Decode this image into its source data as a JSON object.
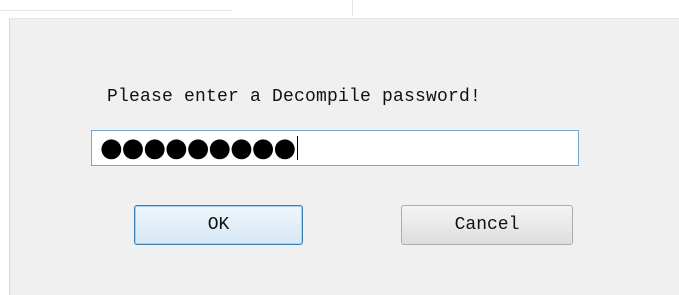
{
  "dialog": {
    "prompt": "Please enter a Decompile password!",
    "password_masked": "●●●●●●●●●",
    "ok_label": "OK",
    "cancel_label": "Cancel"
  }
}
